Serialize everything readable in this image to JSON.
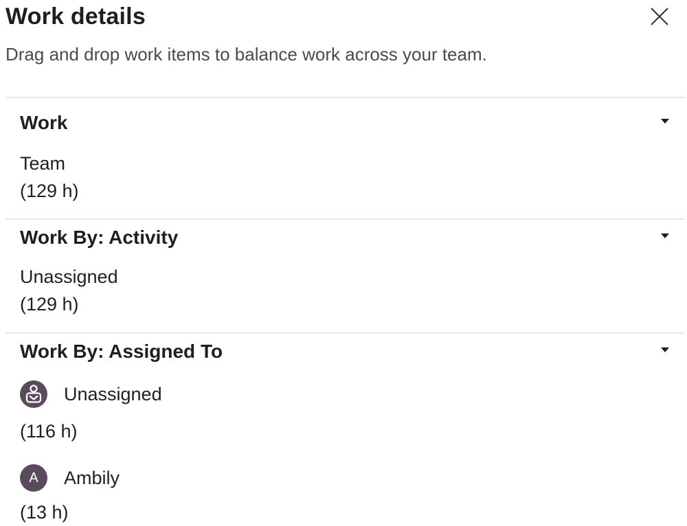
{
  "panel": {
    "title": "Work details",
    "subtitle": "Drag and drop work items to balance work across your team."
  },
  "sections": [
    {
      "title": "Work",
      "items": [
        {
          "name": "Team",
          "hours": "(129 h)"
        }
      ]
    },
    {
      "title": "Work By: Activity",
      "items": [
        {
          "name": "Unassigned",
          "hours": "(129 h)"
        }
      ]
    },
    {
      "title": "Work By: Assigned To",
      "items": [
        {
          "name": "Unassigned",
          "hours": "(116 h)",
          "avatar": "unassigned-user-icon"
        },
        {
          "name": "Ambily",
          "hours": "(13 h)",
          "avatar_letter": "A"
        }
      ]
    }
  ],
  "colors": {
    "avatar": "#5b4a5e",
    "divider": "#e6e6e6",
    "text": "#201f1e",
    "subtitle": "#4a4a4a"
  },
  "icons": {
    "close": "close-icon",
    "section_toggle": "caret-down-icon"
  }
}
